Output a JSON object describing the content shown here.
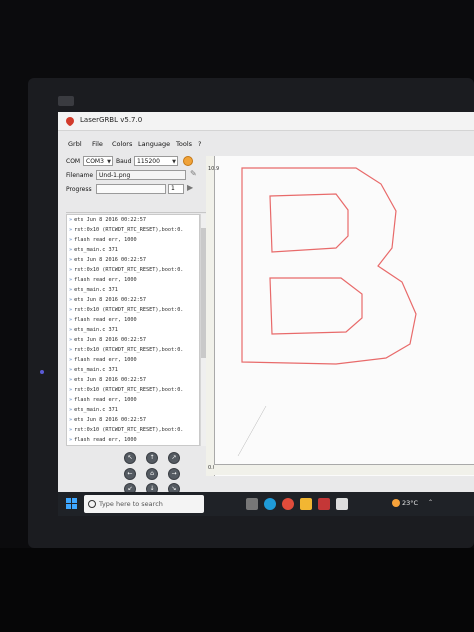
{
  "window": {
    "title": "LaserGRBL v5.7.0"
  },
  "menu": [
    "Grbl",
    "File",
    "Colors",
    "Language",
    "Tools",
    "?"
  ],
  "connection": {
    "com_label": "COM",
    "com_value": "COM3",
    "baud_label": "Baud",
    "baud_value": "115200"
  },
  "file": {
    "filename_label": "Filename",
    "filename_value": "Und-1.png",
    "progress_label": "Progress",
    "copies": "1"
  },
  "log_lines": [
    "ets Jun  8 2016 00:22:57",
    "rst:0x10 (RTCWDT_RTC_RESET),boot:0.",
    "flash read err, 1000",
    "ets_main.c 371",
    "ets Jun  8 2016 00:22:57",
    "rst:0x10 (RTCWDT_RTC_RESET),boot:0.",
    "flash read err, 1000",
    "ets_main.c 371",
    "ets Jun  8 2016 00:22:57",
    "rst:0x10 (RTCWDT_RTC_RESET),boot:0.",
    "flash read err, 1000",
    "ets_main.c 371",
    "ets Jun  8 2016 00:22:57",
    "rst:0x10 (RTCWDT_RTC_RESET),boot:0.",
    "flash read err, 1000",
    "ets_main.c 371",
    "ets Jun  8 2016 00:22:57",
    "rst:0x10 (RTCWDT_RTC_RESET),boot:0.",
    "flash read err, 1000",
    "ets_main.c 371",
    "ets Jun  8 2016 00:22:57",
    "rst:0x10 (RTCWDT_RTC_RESET),boot:0.",
    "flash read err, 1000"
  ],
  "canvas": {
    "y_label": "10.9",
    "origin_label": "0.0",
    "shape_color": "#e86a6a"
  },
  "taskbar": {
    "search_placeholder": "Type here to search",
    "temperature": "23°C"
  },
  "colors": {
    "accent": "#f0a33a",
    "taskbar": "#1f2227"
  }
}
